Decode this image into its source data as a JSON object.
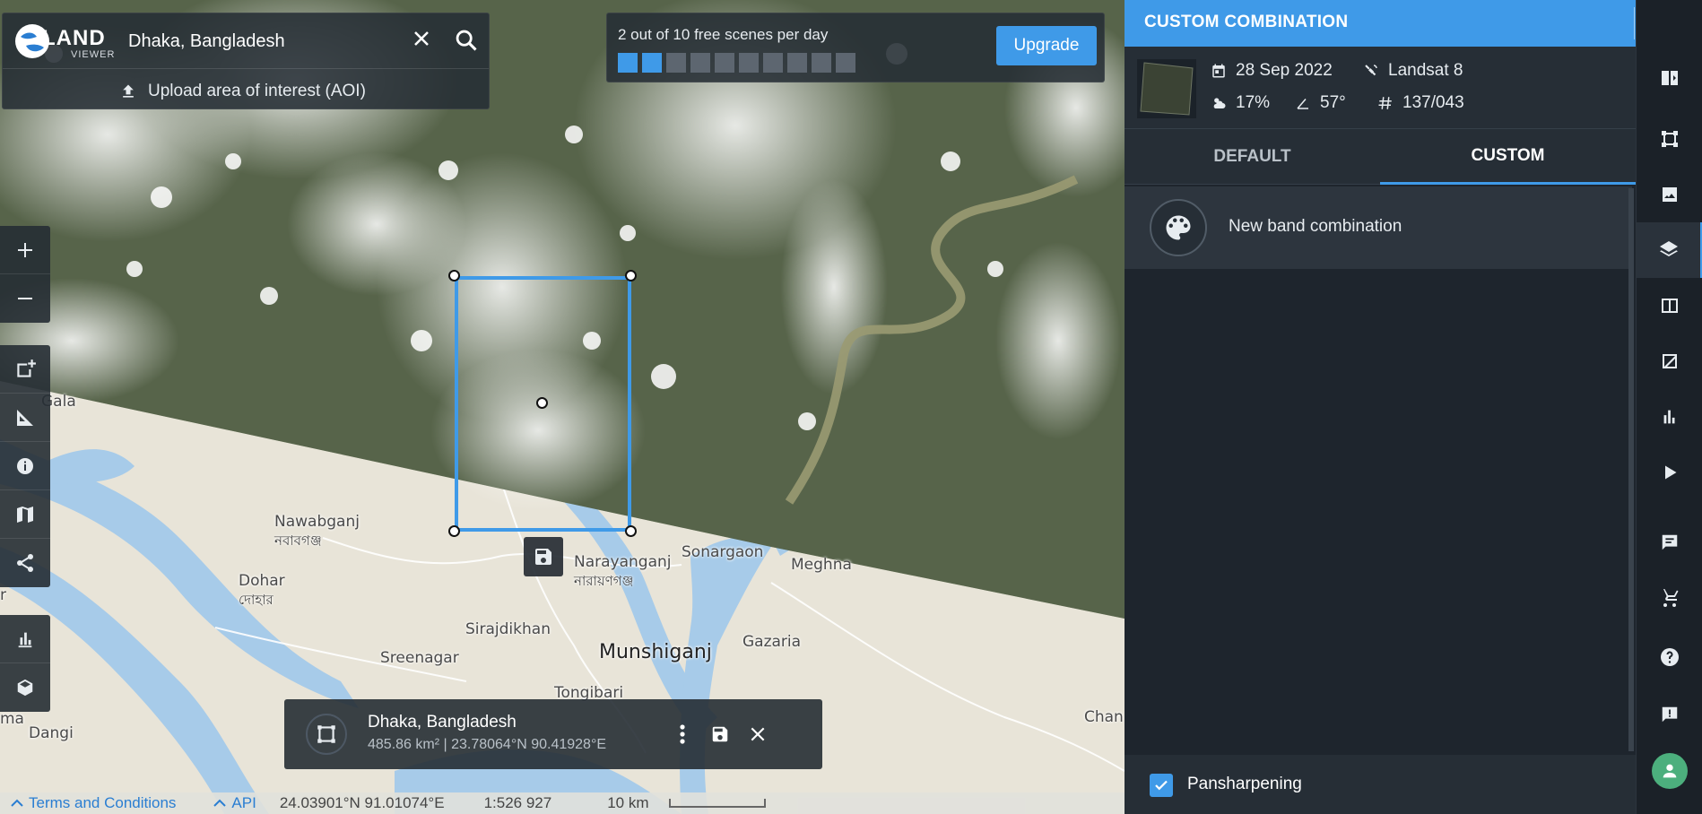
{
  "search": {
    "logo_line1": "LAND",
    "logo_line2": "VIEWER",
    "query": "Dhaka, Bangladesh",
    "upload_label": "Upload area of interest (AOI)"
  },
  "scenes": {
    "label": "2 out of 10 free scenes per day",
    "used": 2,
    "total": 10,
    "upgrade_label": "Upgrade"
  },
  "map_labels": {
    "gala": "Gala",
    "nawabganj": "Nawabganj",
    "nawabganj_bn": "নবাবগঞ্জ",
    "dohar": "Dohar",
    "dohar_bn": "দোহার",
    "narayanganj": "Narayanganj",
    "narayanganj_bn": "নারায়ণগঞ্জ",
    "sonargaon": "Sonargaon",
    "meghna": "Meghna",
    "sirajdikhan": "Sirajdikhan",
    "sreenagar": "Sreenagar",
    "munshiganj": "Munshiganj",
    "gazaria": "Gazaria",
    "tongibari": "Tongibari",
    "dangi": "Dangi",
    "ma": "ma",
    "r": "r",
    "chan": "Chan"
  },
  "aoi": {
    "name": "Dhaka, Bangladesh",
    "meta": "485.86 km² | 23.78064°N 90.41928°E"
  },
  "status": {
    "terms": "Terms and Conditions",
    "api": "API",
    "coords": "24.03901°N 91.01074°E",
    "scale": "1:526 927",
    "distance": "10 km"
  },
  "panel": {
    "title": "CUSTOM COMBINATION",
    "date": "28 Sep 2022",
    "satellite": "Landsat 8",
    "cloud": "17%",
    "angle": "57°",
    "path_row": "137/043",
    "tabs": [
      "DEFAULT",
      "CUSTOM"
    ],
    "new_combo": "New band combination",
    "pansharpening": "Pansharpening"
  },
  "colors": {
    "accent": "#3f9ae8",
    "panel_bg": "#1e252d",
    "water": "#a7cbe9",
    "land": "#e8e4d8",
    "avatar": "#4caf7d"
  }
}
